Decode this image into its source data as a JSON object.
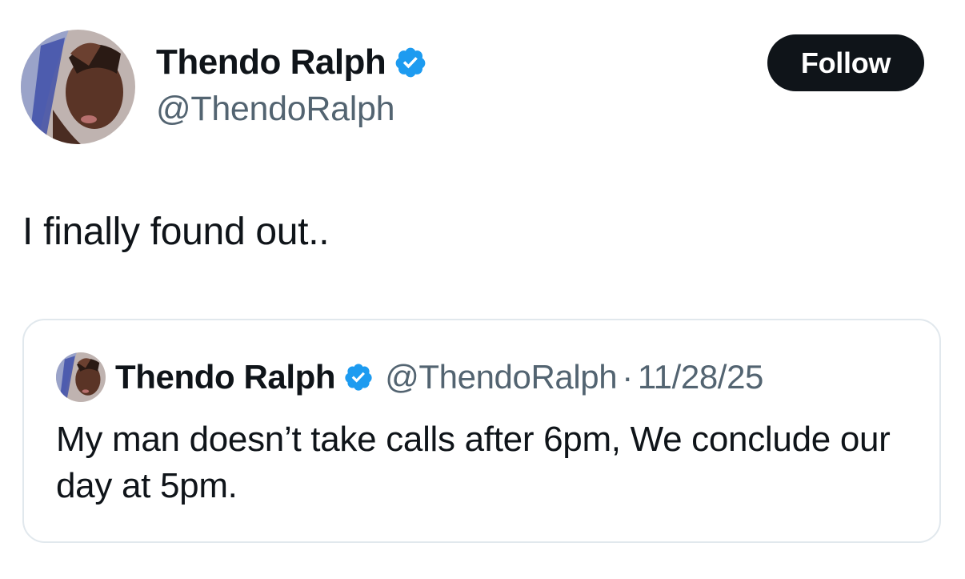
{
  "author": {
    "name": "Thendo Ralph",
    "handle": "@ThendoRalph",
    "verified_icon": "verified-badge-icon"
  },
  "follow_button": {
    "label": "Follow"
  },
  "tweet": {
    "text": "I finally found out.."
  },
  "quoted_tweet": {
    "name": "Thendo Ralph",
    "handle": "@ThendoRalph",
    "separator": "·",
    "date": "11/28/25",
    "text": "My man doesn’t take calls after 6pm, We conclude our day at 5pm."
  },
  "colors": {
    "text_primary": "#0f1419",
    "text_secondary": "#536471",
    "verified_blue": "#1d9bf0",
    "button_bg": "#0f1419",
    "border": "#e1e8ed"
  }
}
